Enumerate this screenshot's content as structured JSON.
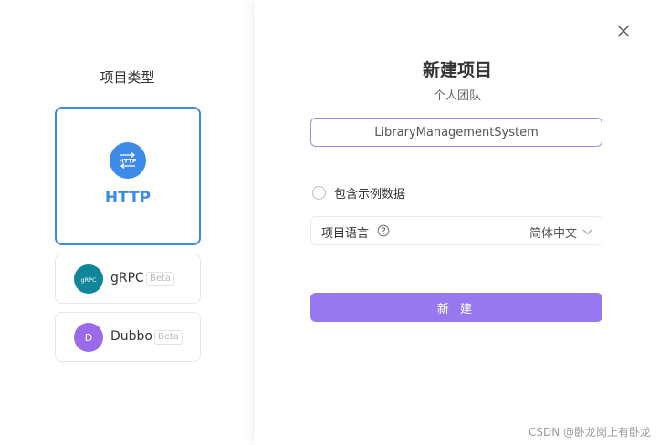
{
  "left_panel": {
    "title": "项目类型",
    "types": [
      {
        "name": "HTTP",
        "icon": "http-icon",
        "icon_text": "HTTP",
        "selected": true
      },
      {
        "name": "gRPC",
        "icon": "grpc-icon",
        "icon_text": "gRPC",
        "badge": "Beta"
      },
      {
        "name": "Dubbo",
        "icon": "dubbo-icon",
        "icon_text": "D",
        "badge": "Beta"
      }
    ]
  },
  "modal": {
    "title": "新建项目",
    "subtitle": "个人团队",
    "project_name": "LibraryManagementSystem",
    "include_sample_label": "包含示例数据",
    "include_sample_checked": false,
    "language_label": "项目语言",
    "language_value": "简体中文",
    "submit_label": "新 建"
  },
  "watermark": "CSDN @卧龙岗上有卧龙",
  "colors": {
    "accent_blue": "#3d8be8",
    "primary_purple": "#9878ee",
    "grpc_teal": "#10869a",
    "dubbo_purple": "#9a6ae8"
  }
}
